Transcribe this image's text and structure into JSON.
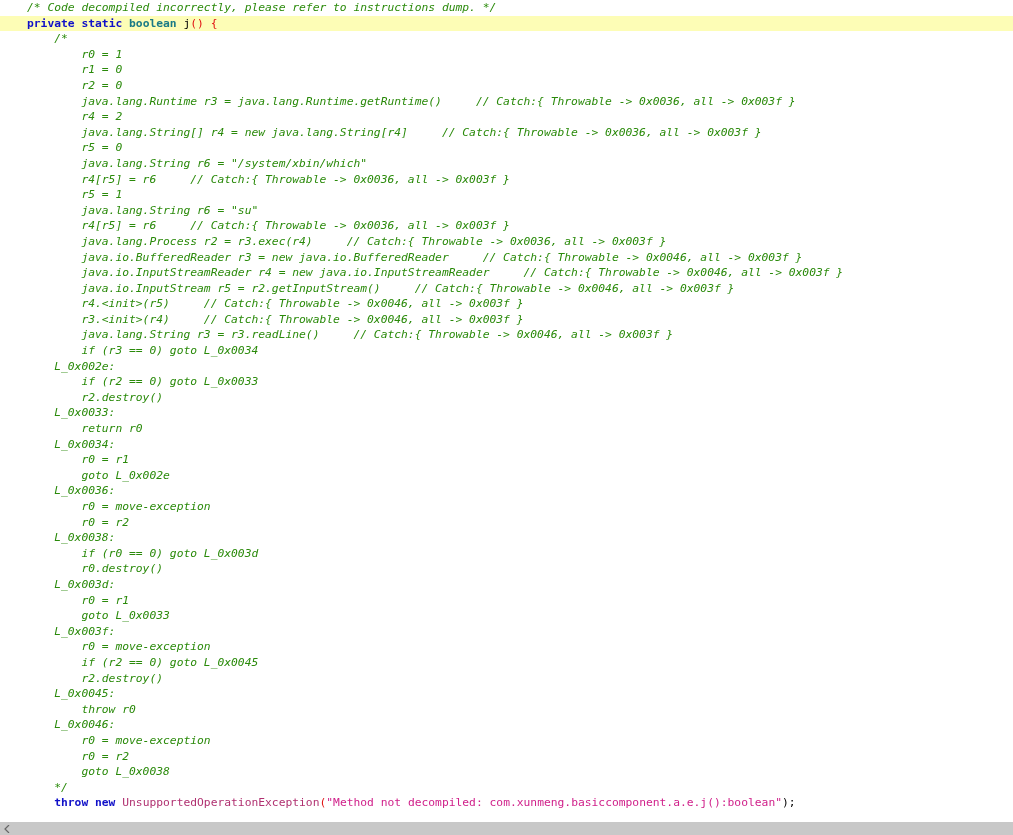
{
  "editor": {
    "lines": [
      {
        "kind": "comment",
        "text": "/* Code decompiled incorrectly, please refer to instructions dump. */"
      },
      {
        "kind": "code",
        "highlighted": true,
        "tokens": [
          {
            "kind": "keyword",
            "text": "private "
          },
          {
            "kind": "keyword",
            "text": "static "
          },
          {
            "kind": "type",
            "text": "boolean "
          },
          {
            "kind": "plain",
            "text": "j"
          },
          {
            "kind": "punct",
            "text": "() {"
          }
        ]
      },
      {
        "kind": "comment",
        "text": "    /*"
      },
      {
        "kind": "comment",
        "text": "        r0 = 1"
      },
      {
        "kind": "comment",
        "text": "        r1 = 0"
      },
      {
        "kind": "comment",
        "text": "        r2 = 0"
      },
      {
        "kind": "comment",
        "text": "        java.lang.Runtime r3 = java.lang.Runtime.getRuntime()     // Catch:{ Throwable -> 0x0036, all -> 0x003f }"
      },
      {
        "kind": "comment",
        "text": "        r4 = 2"
      },
      {
        "kind": "comment",
        "text": "        java.lang.String[] r4 = new java.lang.String[r4]     // Catch:{ Throwable -> 0x0036, all -> 0x003f }"
      },
      {
        "kind": "comment",
        "text": "        r5 = 0"
      },
      {
        "kind": "comment",
        "text": "        java.lang.String r6 = \"/system/xbin/which\""
      },
      {
        "kind": "comment",
        "text": "        r4[r5] = r6     // Catch:{ Throwable -> 0x0036, all -> 0x003f }"
      },
      {
        "kind": "comment",
        "text": "        r5 = 1"
      },
      {
        "kind": "comment",
        "text": "        java.lang.String r6 = \"su\""
      },
      {
        "kind": "comment",
        "text": "        r4[r5] = r6     // Catch:{ Throwable -> 0x0036, all -> 0x003f }"
      },
      {
        "kind": "comment",
        "text": "        java.lang.Process r2 = r3.exec(r4)     // Catch:{ Throwable -> 0x0036, all -> 0x003f }"
      },
      {
        "kind": "comment",
        "text": "        java.io.BufferedReader r3 = new java.io.BufferedReader     // Catch:{ Throwable -> 0x0046, all -> 0x003f }"
      },
      {
        "kind": "comment",
        "text": "        java.io.InputStreamReader r4 = new java.io.InputStreamReader     // Catch:{ Throwable -> 0x0046, all -> 0x003f }"
      },
      {
        "kind": "comment",
        "text": "        java.io.InputStream r5 = r2.getInputStream()     // Catch:{ Throwable -> 0x0046, all -> 0x003f }"
      },
      {
        "kind": "comment",
        "text": "        r4.<init>(r5)     // Catch:{ Throwable -> 0x0046, all -> 0x003f }"
      },
      {
        "kind": "comment",
        "text": "        r3.<init>(r4)     // Catch:{ Throwable -> 0x0046, all -> 0x003f }"
      },
      {
        "kind": "comment",
        "text": "        java.lang.String r3 = r3.readLine()     // Catch:{ Throwable -> 0x0046, all -> 0x003f }"
      },
      {
        "kind": "comment",
        "text": "        if (r3 == 0) goto L_0x0034"
      },
      {
        "kind": "comment",
        "text": "    L_0x002e:"
      },
      {
        "kind": "comment",
        "text": "        if (r2 == 0) goto L_0x0033"
      },
      {
        "kind": "comment",
        "text": "        r2.destroy()"
      },
      {
        "kind": "comment",
        "text": "    L_0x0033:"
      },
      {
        "kind": "comment",
        "text": "        return r0"
      },
      {
        "kind": "comment",
        "text": "    L_0x0034:"
      },
      {
        "kind": "comment",
        "text": "        r0 = r1"
      },
      {
        "kind": "comment",
        "text": "        goto L_0x002e"
      },
      {
        "kind": "comment",
        "text": "    L_0x0036:"
      },
      {
        "kind": "comment",
        "text": "        r0 = move-exception"
      },
      {
        "kind": "comment",
        "text": "        r0 = r2"
      },
      {
        "kind": "comment",
        "text": "    L_0x0038:"
      },
      {
        "kind": "comment",
        "text": "        if (r0 == 0) goto L_0x003d"
      },
      {
        "kind": "comment",
        "text": "        r0.destroy()"
      },
      {
        "kind": "comment",
        "text": "    L_0x003d:"
      },
      {
        "kind": "comment",
        "text": "        r0 = r1"
      },
      {
        "kind": "comment",
        "text": "        goto L_0x0033"
      },
      {
        "kind": "comment",
        "text": "    L_0x003f:"
      },
      {
        "kind": "comment",
        "text": "        r0 = move-exception"
      },
      {
        "kind": "comment",
        "text": "        if (r2 == 0) goto L_0x0045"
      },
      {
        "kind": "comment",
        "text": "        r2.destroy()"
      },
      {
        "kind": "comment",
        "text": "    L_0x0045:"
      },
      {
        "kind": "comment",
        "text": "        throw r0"
      },
      {
        "kind": "comment",
        "text": "    L_0x0046:"
      },
      {
        "kind": "comment",
        "text": "        r0 = move-exception"
      },
      {
        "kind": "comment",
        "text": "        r0 = r2"
      },
      {
        "kind": "comment",
        "text": "        goto L_0x0038"
      },
      {
        "kind": "comment",
        "text": "    */"
      },
      {
        "kind": "code",
        "highlighted": false,
        "tokens": [
          {
            "kind": "keyword",
            "text": "    throw "
          },
          {
            "kind": "keyword",
            "text": "new "
          },
          {
            "kind": "class",
            "text": "UnsupportedOperationException"
          },
          {
            "kind": "punct",
            "text": "("
          },
          {
            "kind": "string",
            "text": "\"Method not decompiled: com.xunmeng.basiccomponent.a.e.j():boolean\""
          },
          {
            "kind": "plain",
            "text": ");"
          }
        ]
      }
    ]
  }
}
